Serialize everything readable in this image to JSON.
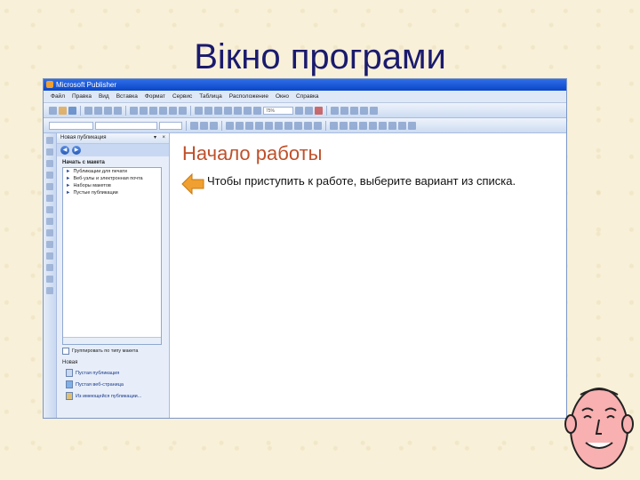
{
  "slide": {
    "title": "Вікно програми"
  },
  "window": {
    "title": "Microsoft Publisher"
  },
  "menu": [
    "Файл",
    "Правка",
    "Вид",
    "Вставка",
    "Формат",
    "Сервис",
    "Таблица",
    "Расположение",
    "Окно",
    "Справка"
  ],
  "toolbar": {
    "zoom": "75%"
  },
  "task_pane": {
    "title": "Новая публикация",
    "nav_back": "◀",
    "nav_forward": "▶",
    "section_title": "Начать с макета",
    "list_items": [
      "Публикации для печати",
      "Веб-узлы и электронная почта",
      "Наборы макетов",
      "Пустые публикации"
    ],
    "checkbox_label": "Группировать по типу макета",
    "new_label": "Новая",
    "links": [
      "Пустая публикация",
      "Пустая веб-страница",
      "Из имеющейся публикации..."
    ]
  },
  "workspace": {
    "heading": "Начало работы",
    "instruction": "Чтобы приступить к работе, выберите вариант из списка."
  },
  "colors": {
    "accent": "#c0502a",
    "titlebar": "#0a46c8",
    "arrow": "#f0a030"
  }
}
